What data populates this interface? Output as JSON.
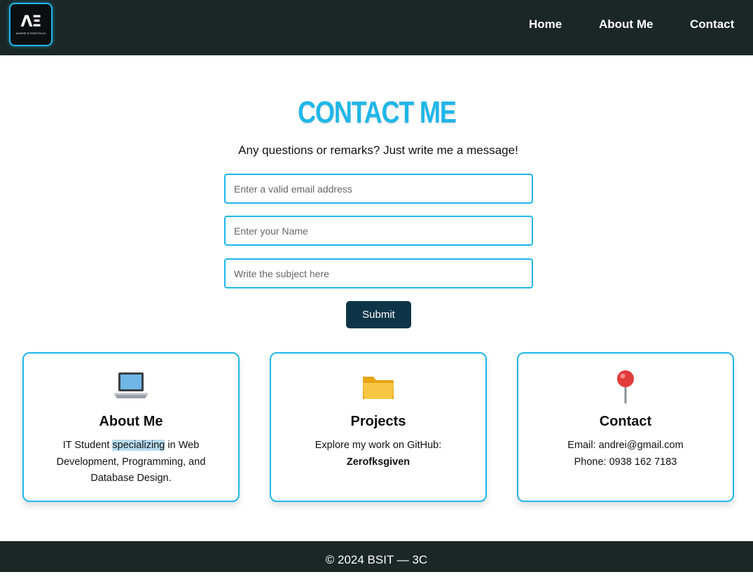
{
  "header": {
    "logo_mark": "ΛΞ",
    "logo_subtext": "ANDREI'S PORTFOLIO",
    "nav": {
      "home": "Home",
      "about": "About Me",
      "contact": "Contact"
    }
  },
  "contact": {
    "title": "CONTACT ME",
    "subtitle": "Any questions or remarks? Just write me a message!",
    "email_placeholder": "Enter a valid email address",
    "name_placeholder": "Enter your Name",
    "subject_placeholder": "Write the subject here",
    "submit_label": "Submit"
  },
  "cards": {
    "about": {
      "icon": "laptop-icon",
      "title": "About Me",
      "text_before": "IT Student ",
      "text_highlight": "specializing",
      "text_after": " in Web Development, Programming, and Database Design."
    },
    "projects": {
      "icon": "folder-icon",
      "title": "Projects",
      "text": "Explore my work on GitHub:",
      "github": "Zerofksgiven"
    },
    "contact": {
      "icon": "pin-icon",
      "title": "Contact",
      "email": "Email: andrei@gmail.com",
      "phone": "Phone: 0938 162 7183"
    }
  },
  "footer": {
    "text": "© 2024 BSIT — 3C"
  },
  "colors": {
    "accent": "#1fb6e8",
    "header_bg": "#1b2626",
    "button_bg": "#0d3547"
  }
}
